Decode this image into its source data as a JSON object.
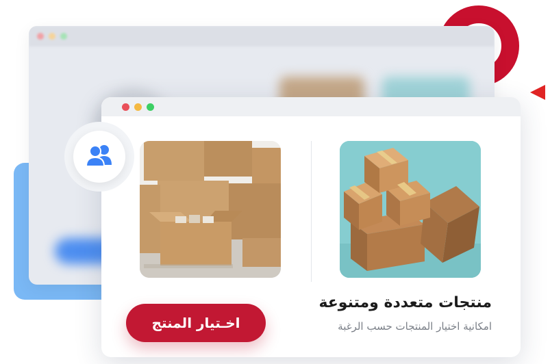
{
  "colors": {
    "accent": "#c21833",
    "ring": "#c8102e",
    "triangle": "#e02424",
    "blue_shape": "#7ab8f5",
    "dot_red": "#e9505a",
    "dot_yellow": "#f4b942",
    "dot_green": "#3ccf64",
    "user_icon": "#3b82f6"
  },
  "icons": {
    "users": "users-icon",
    "boxes_photo": "boxes-photo",
    "stacked_boxes_photo": "stacked-boxes-photo"
  },
  "card": {
    "title": "منتجات متعددة ومتنوعة",
    "subtitle": "امكانية اختيار المنتجات حسب الرغبة",
    "cta_label": "اخـتيار المنتج"
  }
}
